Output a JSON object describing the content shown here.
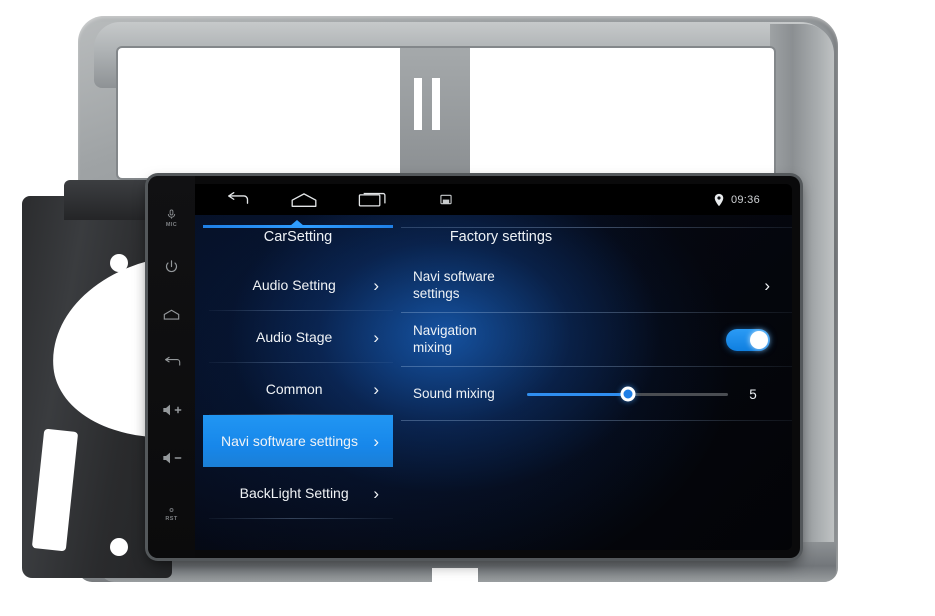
{
  "device": {
    "label": "car-head-unit",
    "hardware_keys": [
      {
        "name": "mic-key",
        "label": "MIC"
      },
      {
        "name": "power-key",
        "label": ""
      },
      {
        "name": "home-key",
        "label": ""
      },
      {
        "name": "back-key",
        "label": ""
      },
      {
        "name": "volume-up-key",
        "label": ""
      },
      {
        "name": "volume-down-key",
        "label": ""
      },
      {
        "name": "reset-key",
        "label": "RST"
      }
    ]
  },
  "statusbar": {
    "nav": {
      "back": "back-icon",
      "home": "home-icon",
      "recents": "recents-icon",
      "screenshot": "screenshot-icon"
    },
    "gps_icon": "location-pin-icon",
    "clock": "09:36"
  },
  "tabs": [
    {
      "label": "CarSetting",
      "active": true
    },
    {
      "label": "Factory settings",
      "active": false
    }
  ],
  "sidebar": {
    "items": [
      {
        "label": "Audio Setting",
        "chevron": "›",
        "active": false
      },
      {
        "label": "Audio Stage",
        "chevron": "›",
        "active": false
      },
      {
        "label": "Common",
        "chevron": "›",
        "active": false
      },
      {
        "label": "Navi software settings",
        "chevron": "›",
        "active": true
      },
      {
        "label": "BackLight Setting",
        "chevron": "›",
        "active": false
      }
    ]
  },
  "panel": {
    "rows": [
      {
        "label": "Navi software settings",
        "type": "link",
        "chevron": "›"
      },
      {
        "label": "Navigation mixing",
        "type": "toggle",
        "value": "on"
      },
      {
        "label": "Sound mixing",
        "type": "slider",
        "value": "5",
        "percent": 50
      }
    ]
  },
  "colors": {
    "accent": "#2196f3",
    "accent_bright": "#2f9dff",
    "screen_bg": "#05070d",
    "text": "#eef2f6",
    "fascia": "#9fa3a5"
  }
}
